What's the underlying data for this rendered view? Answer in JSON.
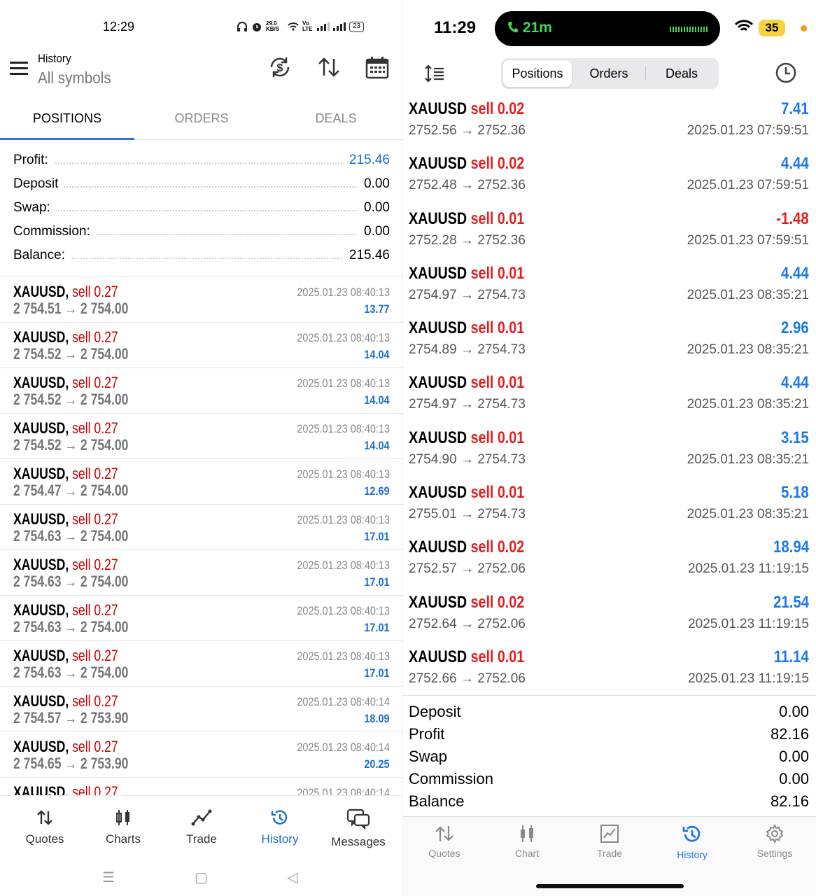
{
  "left": {
    "status": {
      "time": "12:29",
      "net_speed": "29.0 KB/S",
      "lte": "Vo LTE",
      "battery": "23"
    },
    "header": {
      "title": "History",
      "subtitle": "All symbols"
    },
    "tabs": [
      "POSITIONS",
      "ORDERS",
      "DEALS"
    ],
    "summary": [
      {
        "label": "Profit:",
        "value": "215.46",
        "highlight": true
      },
      {
        "label": "Deposit",
        "value": "0.00"
      },
      {
        "label": "Swap:",
        "value": "0.00"
      },
      {
        "label": "Commission:",
        "value": "0.00"
      },
      {
        "label": "Balance:",
        "value": "215.46"
      }
    ],
    "rows": [
      {
        "symbol": "XAUUSD,",
        "side": "sell 0.27",
        "prices": "2 754.51 → 2 754.00",
        "date": "2025.01.23 08:40:13",
        "pl": "13.77"
      },
      {
        "symbol": "XAUUSD,",
        "side": "sell 0.27",
        "prices": "2 754.52 → 2 754.00",
        "date": "2025.01.23 08:40:13",
        "pl": "14.04"
      },
      {
        "symbol": "XAUUSD,",
        "side": "sell 0.27",
        "prices": "2 754.52 → 2 754.00",
        "date": "2025.01.23 08:40:13",
        "pl": "14.04"
      },
      {
        "symbol": "XAUUSD,",
        "side": "sell 0.27",
        "prices": "2 754.52 → 2 754.00",
        "date": "2025.01.23 08:40:13",
        "pl": "14.04"
      },
      {
        "symbol": "XAUUSD,",
        "side": "sell 0.27",
        "prices": "2 754.47 → 2 754.00",
        "date": "2025.01.23 08:40:13",
        "pl": "12.69"
      },
      {
        "symbol": "XAUUSD,",
        "side": "sell 0.27",
        "prices": "2 754.63 → 2 754.00",
        "date": "2025.01.23 08:40:13",
        "pl": "17.01"
      },
      {
        "symbol": "XAUUSD,",
        "side": "sell 0.27",
        "prices": "2 754.63 → 2 754.00",
        "date": "2025.01.23 08:40:13",
        "pl": "17.01"
      },
      {
        "symbol": "XAUUSD,",
        "side": "sell 0.27",
        "prices": "2 754.63 → 2 754.00",
        "date": "2025.01.23 08:40:13",
        "pl": "17.01"
      },
      {
        "symbol": "XAUUSD,",
        "side": "sell 0.27",
        "prices": "2 754.63 → 2 754.00",
        "date": "2025.01.23 08:40:13",
        "pl": "17.01"
      },
      {
        "symbol": "XAUUSD,",
        "side": "sell 0.27",
        "prices": "2 754.57 → 2 753.90",
        "date": "2025.01.23 08:40:14",
        "pl": "18.09"
      },
      {
        "symbol": "XAUUSD,",
        "side": "sell 0.27",
        "prices": "2 754.65 → 2 753.90",
        "date": "2025.01.23 08:40:14",
        "pl": "20.25"
      },
      {
        "symbol": "XAUUSD,",
        "side": "sell 0.27",
        "prices": "",
        "date": "2025.01.23 08:40:14",
        "pl": ""
      }
    ],
    "nav": [
      "Quotes",
      "Charts",
      "Trade",
      "History",
      "Messages"
    ],
    "colors": {
      "accent": "#1a6fc9",
      "sell": "#c80000",
      "tab_underline": "#2878d4"
    }
  },
  "right": {
    "status": {
      "time": "11:29",
      "call": "21m",
      "battery": "35"
    },
    "segments": [
      "Positions",
      "Orders",
      "Deals"
    ],
    "rows": [
      {
        "symbol": "XAUUSD",
        "side": "sell 0.02",
        "prices": "2752.56 → 2752.36",
        "date": "2025.01.23 07:59:51",
        "pl": "7.41",
        "neg": false
      },
      {
        "symbol": "XAUUSD",
        "side": "sell 0.02",
        "prices": "2752.48 → 2752.36",
        "date": "2025.01.23 07:59:51",
        "pl": "4.44",
        "neg": false
      },
      {
        "symbol": "XAUUSD",
        "side": "sell 0.01",
        "prices": "2752.28 → 2752.36",
        "date": "2025.01.23 07:59:51",
        "pl": "-1.48",
        "neg": true
      },
      {
        "symbol": "XAUUSD",
        "side": "sell 0.01",
        "prices": "2754.97 → 2754.73",
        "date": "2025.01.23 08:35:21",
        "pl": "4.44",
        "neg": false
      },
      {
        "symbol": "XAUUSD",
        "side": "sell 0.01",
        "prices": "2754.89 → 2754.73",
        "date": "2025.01.23 08:35:21",
        "pl": "2.96",
        "neg": false
      },
      {
        "symbol": "XAUUSD",
        "side": "sell 0.01",
        "prices": "2754.97 → 2754.73",
        "date": "2025.01.23 08:35:21",
        "pl": "4.44",
        "neg": false
      },
      {
        "symbol": "XAUUSD",
        "side": "sell 0.01",
        "prices": "2754.90 → 2754.73",
        "date": "2025.01.23 08:35:21",
        "pl": "3.15",
        "neg": false
      },
      {
        "symbol": "XAUUSD",
        "side": "sell 0.01",
        "prices": "2755.01 → 2754.73",
        "date": "2025.01.23 08:35:21",
        "pl": "5.18",
        "neg": false
      },
      {
        "symbol": "XAUUSD",
        "side": "sell 0.02",
        "prices": "2752.57 → 2752.06",
        "date": "2025.01.23 11:19:15",
        "pl": "18.94",
        "neg": false
      },
      {
        "symbol": "XAUUSD",
        "side": "sell 0.02",
        "prices": "2752.64 → 2752.06",
        "date": "2025.01.23 11:19:15",
        "pl": "21.54",
        "neg": false
      },
      {
        "symbol": "XAUUSD",
        "side": "sell 0.01",
        "prices": "2752.66 → 2752.06",
        "date": "2025.01.23 11:19:15",
        "pl": "11.14",
        "neg": false
      }
    ],
    "summary": [
      {
        "label": "Deposit",
        "value": "0.00"
      },
      {
        "label": "Profit",
        "value": "82.16"
      },
      {
        "label": "Swap",
        "value": "0.00"
      },
      {
        "label": "Commission",
        "value": "0.00"
      },
      {
        "label": "Balance",
        "value": "82.16"
      }
    ],
    "nav": [
      "Quotes",
      "Chart",
      "Trade",
      "History",
      "Settings"
    ],
    "colors": {
      "accent": "#1c78e8",
      "sell": "#e02020",
      "positive": "#1c78e8",
      "negative": "#e02020"
    }
  }
}
